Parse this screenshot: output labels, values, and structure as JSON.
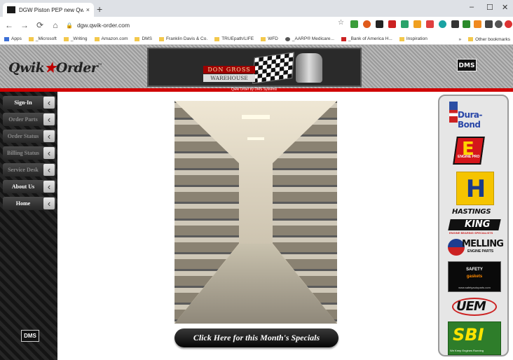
{
  "browser": {
    "tab_title": "DGW Piston PEP new QwikOrder",
    "tab_close": "×",
    "new_tab": "+",
    "url": "dgw.qwik-order.com",
    "window_minimize": "–",
    "window_maximize": "☐",
    "window_close": "✕",
    "bookmarks": [
      "Apps",
      "_Microsoft",
      "_Writing",
      "Amazon.com",
      "DMS",
      "Franklin Davis & Co.",
      "TRUEpath/LIFE",
      "WFD",
      "_AARP® Medicare...",
      "_Bank of America H...",
      "Inspiration"
    ],
    "other_bookmarks": "Other bookmarks",
    "more_bookmarks": "»"
  },
  "site": {
    "logo": "Qwik",
    "logo_star": "★",
    "logo2": "Order",
    "logo_tm": "™",
    "banner_line1": "DON GROSS",
    "banner_line2": "WAREHOUSE",
    "dms": "DMS",
    "byline": "Qwik Order by DMS Systems",
    "nav": [
      {
        "label": "Sign-In",
        "active": true
      },
      {
        "label": "Order Parts",
        "active": false
      },
      {
        "label": "Order Status",
        "active": false
      },
      {
        "label": "Billing Status",
        "active": false
      },
      {
        "label": "Service Desk",
        "active": false
      },
      {
        "label": "About Us",
        "active": true
      },
      {
        "label": "Home",
        "active": true
      }
    ],
    "specials_button": "Click Here for this Month's Specials",
    "brands": {
      "durabond": "Dura-Bond",
      "enginepro_text": "ENGINE PRO",
      "hastings": "HASTINGS",
      "king": "KING",
      "king_sub": "ENGINE BEARING SPECIALISTS",
      "melling": "MELLING",
      "melling_sub": "ENGINE PARTS",
      "safety_line1": "SAFETY",
      "safety_line2": "gaskets",
      "safety_line3": "www.safetyautoparts.com",
      "uem": "UEM",
      "sbi": "SBI",
      "sbi_sub": "We Keep Engines Running"
    }
  }
}
